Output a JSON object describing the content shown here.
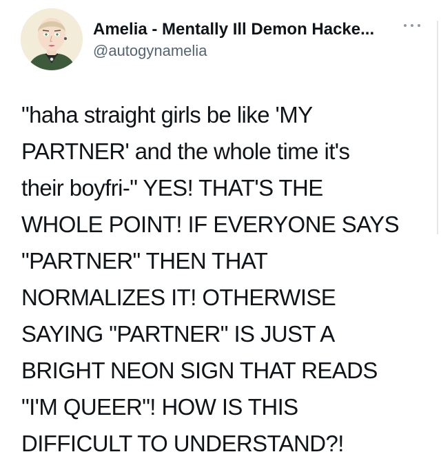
{
  "author": {
    "display_name": "Amelia - Mentally Ill Demon Hacke...",
    "handle": "@autogynamelia",
    "avatar_icon": "illustrated-portrait-avatar"
  },
  "more_icon": "more-options-ellipsis-icon",
  "tweet": {
    "text": "\"haha straight girls be like 'MY\nPARTNER' and the whole time it's\ntheir boyfri-\" YES! THAT'S THE\nWHOLE POINT! IF EVERYONE SAYS\n\"PARTNER\" THEN THAT\nNORMALIZES IT! OTHERWISE\nSAYING \"PARTNER\" IS JUST A\nBRIGHT NEON SIGN THAT READS\n\"I'M QUEER\"! HOW IS THIS\nDIFFICULT TO UNDERSTAND?!"
  },
  "colors": {
    "text": "#0f1419",
    "secondary_text": "#536471",
    "background": "#ffffff"
  }
}
